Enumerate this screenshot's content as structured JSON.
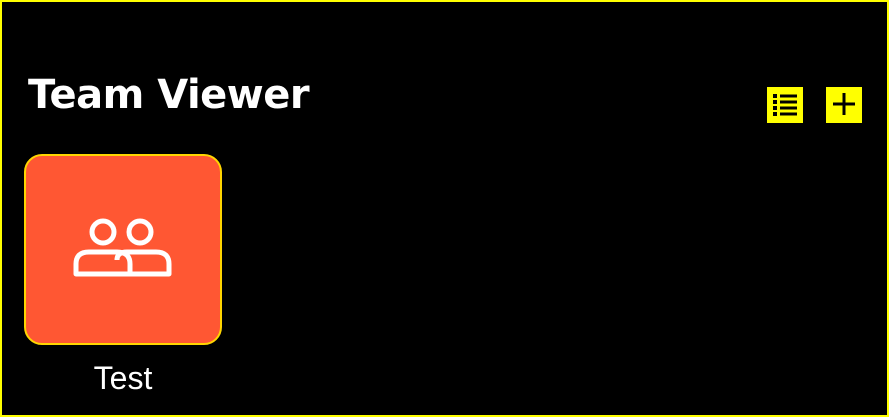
{
  "header": {
    "title": "Team Viewer",
    "list_view_icon": "list-icon",
    "add_icon": "plus-icon"
  },
  "teams": [
    {
      "name": "Test",
      "icon": "group-icon",
      "color": "#ff5733"
    }
  ],
  "colors": {
    "background": "#000000",
    "accent": "#ffff00",
    "card_border": "#ffd500",
    "text": "#ffffff"
  }
}
